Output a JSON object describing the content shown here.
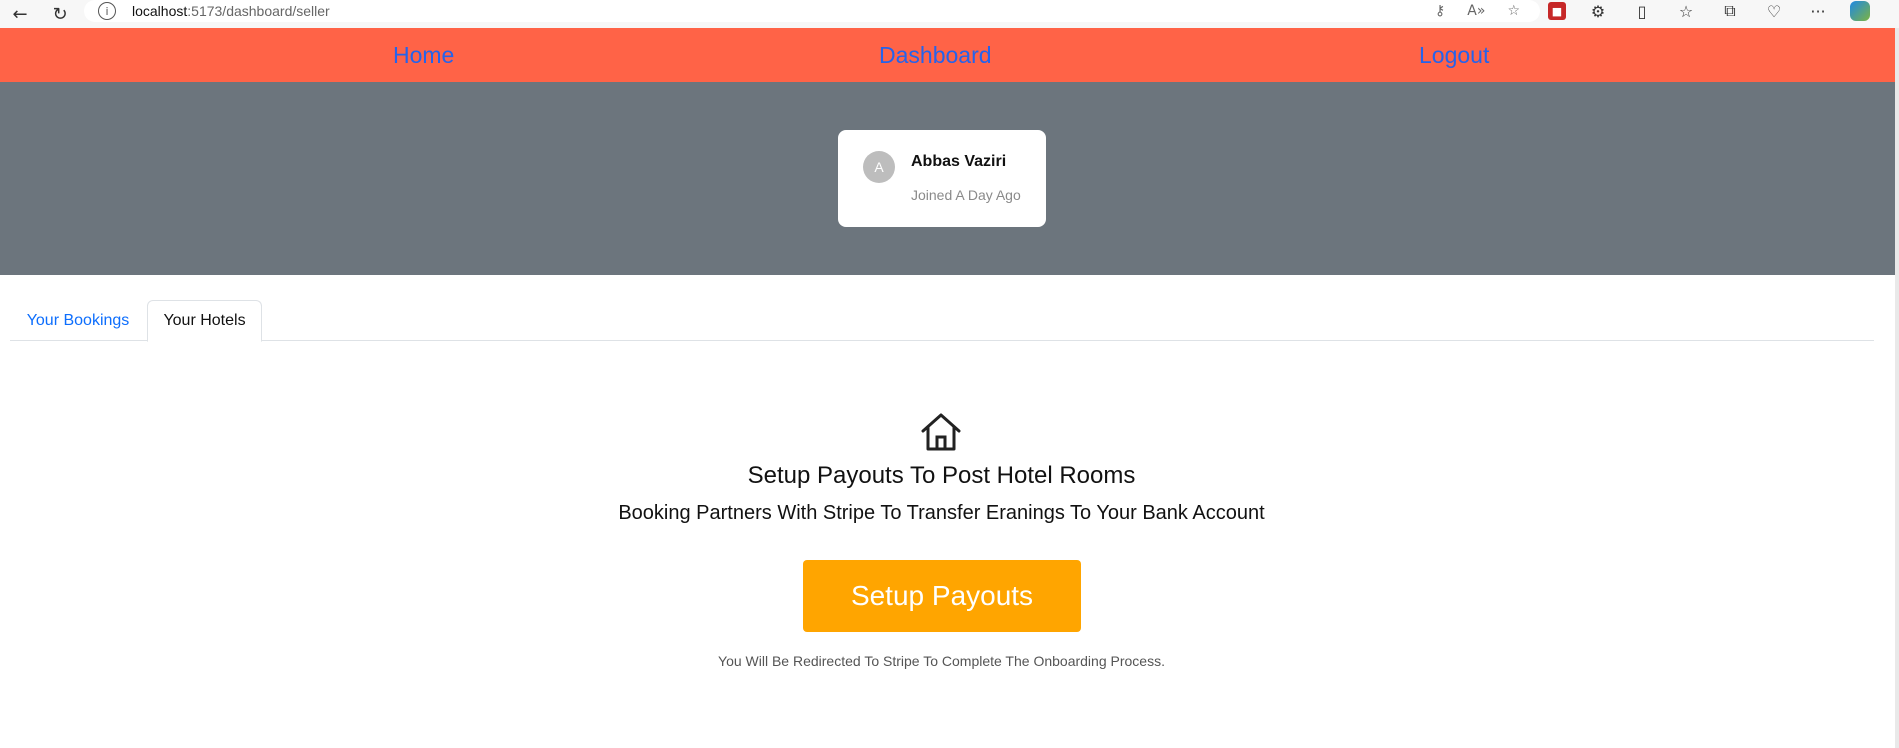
{
  "browser": {
    "url_host": "localhost",
    "url_path": ":5173/dashboard/seller"
  },
  "nav": {
    "home": "Home",
    "dashboard": "Dashboard",
    "logout": "Logout"
  },
  "profile": {
    "avatar_letter": "A",
    "name": "Abbas Vaziri",
    "joined": "Joined A Day Ago"
  },
  "tabs": [
    {
      "label": "Your Bookings",
      "active": false
    },
    {
      "label": "Your Hotels",
      "active": true
    }
  ],
  "payouts": {
    "title": "Setup Payouts To Post Hotel Rooms",
    "subtitle": "Booking Partners With Stripe To Transfer Eranings To Your Bank Account",
    "button_label": "Setup Payouts",
    "note": "You Will Be Redirected To Stripe To Complete The Onboarding Process."
  },
  "colors": {
    "nav_bg": "#ff6347",
    "nav_link": "#2563eb",
    "hero_bg": "#6c757d",
    "button_bg": "#ffa500",
    "tab_link": "#0d6efd"
  },
  "icons": {
    "back": "arrow-left-icon",
    "reload": "refresh-icon",
    "site_info": "info-icon",
    "house": "house-icon"
  }
}
